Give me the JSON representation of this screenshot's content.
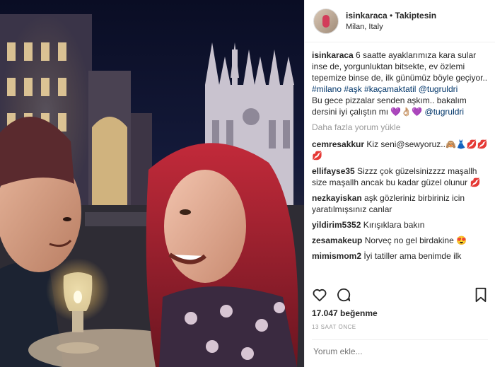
{
  "post": {
    "username": "isinkaraca",
    "separator": " • ",
    "follow_label": "Takiptesin",
    "location": "Milan, Italy"
  },
  "caption": {
    "username": "isinkaraca",
    "text": " 6 saatte ayaklarımıza kara sular inse de, yorgunluktan bitsekte, ev özlemi tepemize binse de, ilk günümüz böyle geçiyor..",
    "hashtags": "#milano #aşk #kaçamaktatil @tugruldri",
    "line2": "Bu gece pizzalar senden aşkım.. bakalım dersini iyi çalıştın mı 💜👌🏼💜 ",
    "mention2": "@tugruldri"
  },
  "load_more": "Daha fazla yorum yükle",
  "comments": [
    {
      "user": "cemresakkur",
      "text": " Kiz seni@sewyoruz..🙈👗💋💋💋"
    },
    {
      "user": "ellifayse35",
      "text": " Sizzz çok güzelsinizzzz maşallh size maşallh ancak bu kadar güzel olunur 💋"
    },
    {
      "user": "nezkayiskan",
      "text": " aşk gözleriniz birbiriniz icin yaratılmışsınız canlar"
    },
    {
      "user": "yildirim5352",
      "text": " Kırışıklara bakın"
    },
    {
      "user": "zesamakeup",
      "text": " Norveç no gel birdakine 😍"
    },
    {
      "user": "mimismom2",
      "text": " İyi tatiller ama benimde ilk"
    }
  ],
  "likes_count": "17.047",
  "likes_label": " beğenme",
  "time_ago": "13 SAAT ÖNCE",
  "comment_placeholder": "Yorum ekle...",
  "icons": {
    "like": "heart-icon",
    "comment": "comment-icon",
    "save": "bookmark-icon"
  }
}
